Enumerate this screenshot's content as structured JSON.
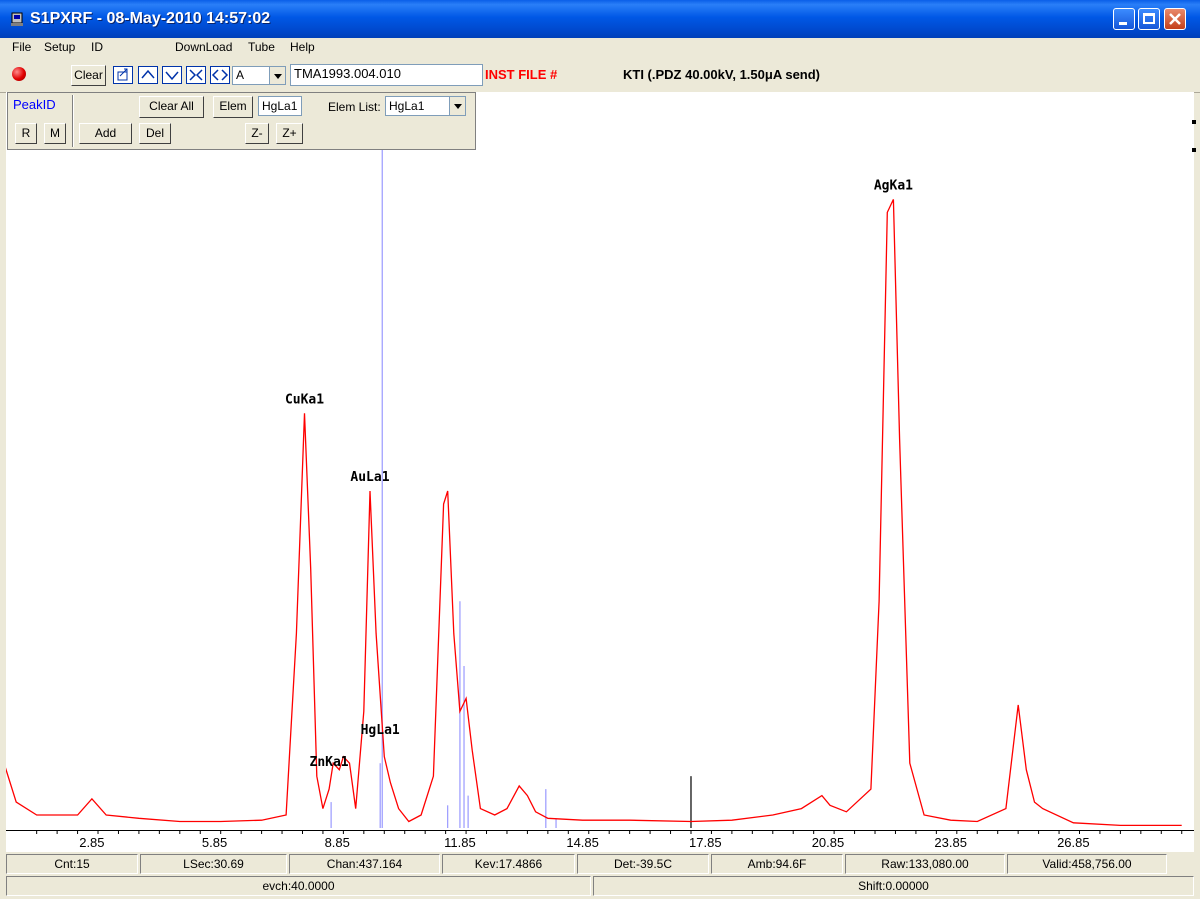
{
  "window": {
    "title": "S1PXRF - 08-May-2010 14:57:02"
  },
  "menu": [
    "File",
    "Setup",
    "ID",
    "DownLoad",
    "Tube",
    "Help"
  ],
  "toolbar": {
    "clear_label": "Clear",
    "mode_value": "A",
    "sample_id": "TMA1993.004.010",
    "inst_file": "INST FILE #",
    "tube_info": "KTI  (.PDZ 40.00kV, 1.50μA send)"
  },
  "peakid": {
    "title": "PeakID",
    "r_label": "R",
    "m_label": "M",
    "clear_all_label": "Clear All",
    "elem_label": "Elem",
    "elem_value": "HgLa1",
    "elem_list_label": "Elem List:",
    "elem_list_value": "HgLa1",
    "add_label": "Add",
    "del_label": "Del",
    "zminus_label": "Z-",
    "zplus_label": "Z+"
  },
  "chart_data": {
    "type": "line",
    "series": [
      {
        "values": [
          [
            0.7,
            0.1
          ],
          [
            1.0,
            0.04
          ],
          [
            1.5,
            0.02
          ],
          [
            2.0,
            0.02
          ],
          [
            2.5,
            0.02
          ],
          [
            2.85,
            0.045
          ],
          [
            3.2,
            0.02
          ],
          [
            4.0,
            0.015
          ],
          [
            5.0,
            0.01
          ],
          [
            6.0,
            0.01
          ],
          [
            7.0,
            0.012
          ],
          [
            7.6,
            0.02
          ],
          [
            7.85,
            0.3
          ],
          [
            8.05,
            0.64
          ],
          [
            8.2,
            0.4
          ],
          [
            8.35,
            0.08
          ],
          [
            8.5,
            0.03
          ],
          [
            8.65,
            0.06
          ],
          [
            8.75,
            0.1
          ],
          [
            8.9,
            0.09
          ],
          [
            9.0,
            0.11
          ],
          [
            9.15,
            0.1
          ],
          [
            9.3,
            0.03
          ],
          [
            9.5,
            0.18
          ],
          [
            9.65,
            0.52
          ],
          [
            9.8,
            0.3
          ],
          [
            10.0,
            0.11
          ],
          [
            10.15,
            0.07
          ],
          [
            10.35,
            0.03
          ],
          [
            10.6,
            0.01
          ],
          [
            10.9,
            0.02
          ],
          [
            11.2,
            0.08
          ],
          [
            11.45,
            0.5
          ],
          [
            11.55,
            0.52
          ],
          [
            11.7,
            0.3
          ],
          [
            11.85,
            0.18
          ],
          [
            12.0,
            0.2
          ],
          [
            12.15,
            0.12
          ],
          [
            12.35,
            0.03
          ],
          [
            12.7,
            0.02
          ],
          [
            13.0,
            0.03
          ],
          [
            13.3,
            0.065
          ],
          [
            13.5,
            0.05
          ],
          [
            13.7,
            0.025
          ],
          [
            14.0,
            0.015
          ],
          [
            14.85,
            0.012
          ],
          [
            16.0,
            0.012
          ],
          [
            17.5,
            0.01
          ],
          [
            18.5,
            0.012
          ],
          [
            19.5,
            0.02
          ],
          [
            20.2,
            0.03
          ],
          [
            20.7,
            0.05
          ],
          [
            20.9,
            0.035
          ],
          [
            21.3,
            0.025
          ],
          [
            21.9,
            0.06
          ],
          [
            22.1,
            0.35
          ],
          [
            22.3,
            0.95
          ],
          [
            22.45,
            0.97
          ],
          [
            22.6,
            0.6
          ],
          [
            22.85,
            0.1
          ],
          [
            23.2,
            0.02
          ],
          [
            23.85,
            0.012
          ],
          [
            24.5,
            0.01
          ],
          [
            25.2,
            0.03
          ],
          [
            25.5,
            0.19
          ],
          [
            25.7,
            0.09
          ],
          [
            25.9,
            0.04
          ],
          [
            26.1,
            0.03
          ],
          [
            26.85,
            0.008
          ],
          [
            28.0,
            0.004
          ],
          [
            29.5,
            0.004
          ]
        ],
        "color": "#ff0000"
      }
    ],
    "xticks": [
      "2.85",
      "5.85",
      "8.85",
      "11.85",
      "14.85",
      "17.85",
      "20.85",
      "23.85",
      "26.85"
    ],
    "xlim": [
      0.75,
      29.8
    ],
    "ylim": [
      0,
      1
    ],
    "annotations": [
      {
        "label": "AgKa1",
        "x": 22.45,
        "y": 0.97
      },
      {
        "label": "CuKa1",
        "x": 8.05,
        "y": 0.64
      },
      {
        "label": "AuLa1",
        "x": 9.65,
        "y": 0.52
      },
      {
        "label": "HgLa1",
        "x": 9.9,
        "y": 0.13
      },
      {
        "label": "ZnKa1",
        "x": 8.65,
        "y": 0.08
      }
    ],
    "marker_lines": [
      {
        "x": 9.95,
        "h": 1.0,
        "color": "#9999ff"
      },
      {
        "x": 8.7,
        "h": 0.04,
        "color": "#9999ff"
      },
      {
        "x": 9.9,
        "h": 0.1,
        "color": "#9999ff"
      },
      {
        "x": 11.55,
        "h": 0.035,
        "color": "#9999ff"
      },
      {
        "x": 11.85,
        "h": 0.35,
        "color": "#9999ff"
      },
      {
        "x": 11.95,
        "h": 0.25,
        "color": "#9999ff"
      },
      {
        "x": 12.05,
        "h": 0.05,
        "color": "#9999ff"
      },
      {
        "x": 13.95,
        "h": 0.06,
        "color": "#9999ff"
      },
      {
        "x": 14.2,
        "h": 0.015,
        "color": "#9999ff"
      },
      {
        "x": 17.5,
        "h": 0.08,
        "color": "#000000"
      }
    ]
  },
  "status": {
    "cnt": "Cnt:15",
    "lsec": "LSec:30.69",
    "chan": "Chan:437.164",
    "kev": "Kev:17.4866",
    "det": "Det:-39.5C",
    "amb": "Amb:94.6F",
    "raw": "Raw:133,080.00",
    "valid": "Valid:458,756.00",
    "evch": "evch:40.0000",
    "shift": "Shift:0.00000"
  }
}
